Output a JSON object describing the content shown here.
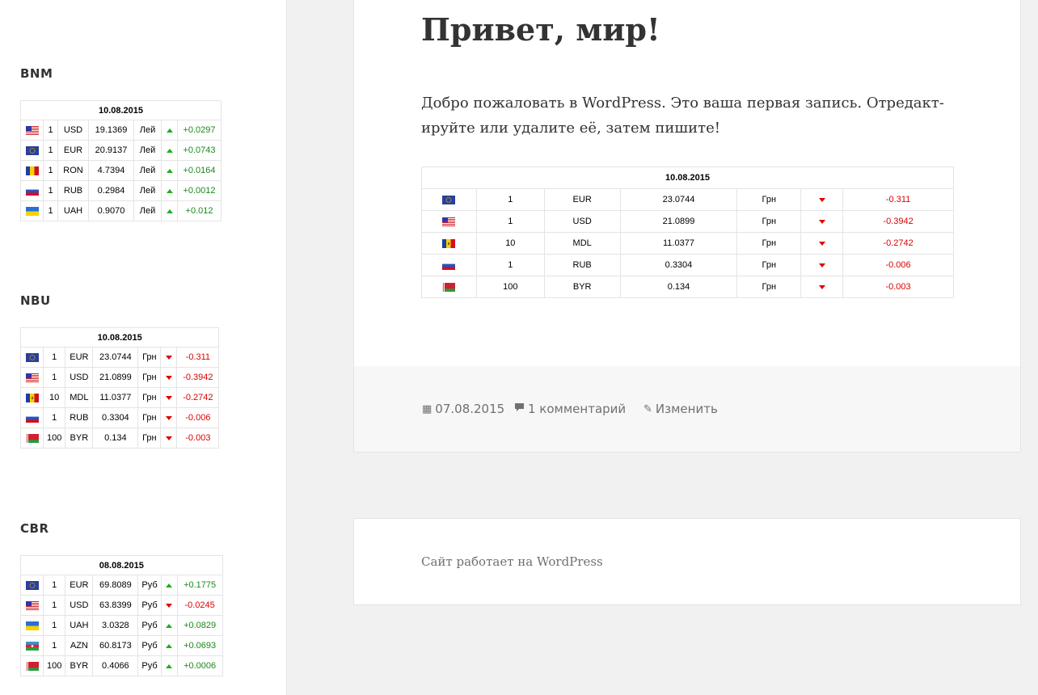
{
  "sidebar": {
    "widgets": [
      {
        "title": "BNM",
        "date": "10.08.2015",
        "rows": [
          {
            "flag": "us-flag",
            "nominal": "1",
            "code": "USD",
            "rate": "19.1369",
            "unit": "Лей",
            "trend": "up",
            "change": "+0.0297"
          },
          {
            "flag": "eu-flag",
            "nominal": "1",
            "code": "EUR",
            "rate": "20.9137",
            "unit": "Лей",
            "trend": "up",
            "change": "+0.0743"
          },
          {
            "flag": "ro-flag",
            "nominal": "1",
            "code": "RON",
            "rate": "4.7394",
            "unit": "Лей",
            "trend": "up",
            "change": "+0.0164"
          },
          {
            "flag": "ru-flag",
            "nominal": "1",
            "code": "RUB",
            "rate": "0.2984",
            "unit": "Лей",
            "trend": "up",
            "change": "+0.0012"
          },
          {
            "flag": "ua-flag",
            "nominal": "1",
            "code": "UAH",
            "rate": "0.9070",
            "unit": "Лей",
            "trend": "up",
            "change": "+0.012"
          }
        ]
      },
      {
        "title": "NBU",
        "date": "10.08.2015",
        "rows": [
          {
            "flag": "eu-flag",
            "nominal": "1",
            "code": "EUR",
            "rate": "23.0744",
            "unit": "Грн",
            "trend": "down",
            "change": "-0.311"
          },
          {
            "flag": "us-flag",
            "nominal": "1",
            "code": "USD",
            "rate": "21.0899",
            "unit": "Грн",
            "trend": "down",
            "change": "-0.3942"
          },
          {
            "flag": "md-flag",
            "nominal": "10",
            "code": "MDL",
            "rate": "11.0377",
            "unit": "Грн",
            "trend": "down",
            "change": "-0.2742"
          },
          {
            "flag": "ru-flag",
            "nominal": "1",
            "code": "RUB",
            "rate": "0.3304",
            "unit": "Грн",
            "trend": "down",
            "change": "-0.006"
          },
          {
            "flag": "by-flag",
            "nominal": "100",
            "code": "BYR",
            "rate": "0.134",
            "unit": "Грн",
            "trend": "down",
            "change": "-0.003"
          }
        ]
      },
      {
        "title": "CBR",
        "date": "08.08.2015",
        "rows": [
          {
            "flag": "eu-flag",
            "nominal": "1",
            "code": "EUR",
            "rate": "69.8089",
            "unit": "Руб",
            "trend": "up",
            "change": "+0.1775"
          },
          {
            "flag": "us-flag",
            "nominal": "1",
            "code": "USD",
            "rate": "63.8399",
            "unit": "Руб",
            "trend": "down",
            "change": "-0.0245"
          },
          {
            "flag": "ua-flag",
            "nominal": "1",
            "code": "UAH",
            "rate": "3.0328",
            "unit": "Руб",
            "trend": "up",
            "change": "+0.0829"
          },
          {
            "flag": "az-flag",
            "nominal": "1",
            "code": "AZN",
            "rate": "60.8173",
            "unit": "Руб",
            "trend": "up",
            "change": "+0.0693"
          },
          {
            "flag": "by-flag",
            "nominal": "100",
            "code": "BYR",
            "rate": "0.4066",
            "unit": "Руб",
            "trend": "up",
            "change": "+0.0006"
          }
        ]
      }
    ]
  },
  "post": {
    "title": "Привет, мир!",
    "body": "Добро пожаловать в WordPress. Это ваша первая запись. Отредакт­ируйте или удалите её, затем пишите!",
    "table": {
      "date": "10.08.2015",
      "rows": [
        {
          "flag": "eu-flag",
          "nominal": "1",
          "code": "EUR",
          "rate": "23.0744",
          "unit": "Грн",
          "trend": "down",
          "change": "-0.311"
        },
        {
          "flag": "us-flag",
          "nominal": "1",
          "code": "USD",
          "rate": "21.0899",
          "unit": "Грн",
          "trend": "down",
          "change": "-0.3942"
        },
        {
          "flag": "md-flag",
          "nominal": "10",
          "code": "MDL",
          "rate": "11.0377",
          "unit": "Грн",
          "trend": "down",
          "change": "-0.2742"
        },
        {
          "flag": "ru-flag",
          "nominal": "1",
          "code": "RUB",
          "rate": "0.3304",
          "unit": "Грн",
          "trend": "down",
          "change": "-0.006"
        },
        {
          "flag": "by-flag",
          "nominal": "100",
          "code": "BYR",
          "rate": "0.134",
          "unit": "Грн",
          "trend": "down",
          "change": "-0.003"
        }
      ]
    },
    "meta": {
      "date": "07.08.2015",
      "comments": "1 комментарий",
      "edit": "Изменить"
    }
  },
  "footer": {
    "text": "Сайт работает на WordPress"
  },
  "colors": {
    "up": "#1b8a1b",
    "down": "#dd0000",
    "background": "#f1f1f1"
  }
}
